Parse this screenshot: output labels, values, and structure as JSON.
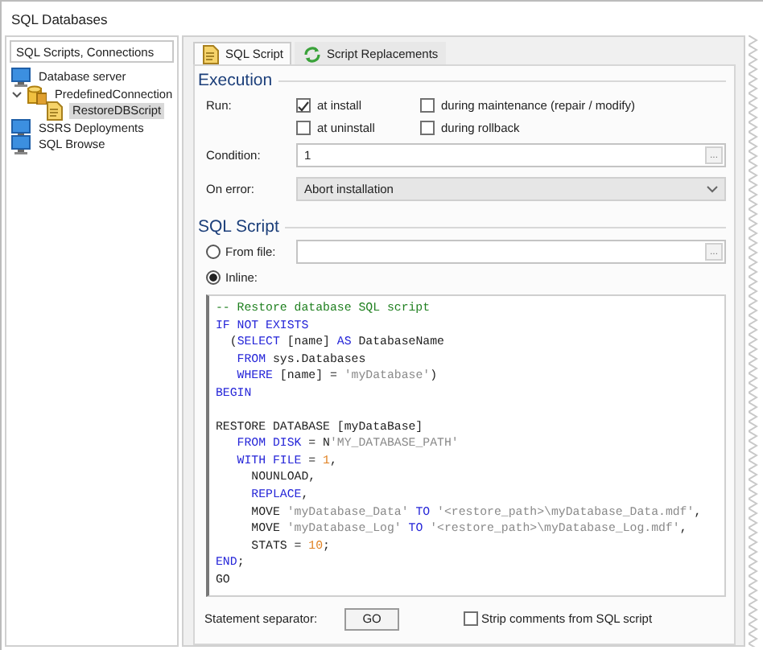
{
  "window": {
    "title": "SQL Databases"
  },
  "sidebar": {
    "header": "SQL Scripts, Connections",
    "items": [
      {
        "label": "Database server",
        "kind": "server",
        "selected": false
      },
      {
        "label": "PredefinedConnection",
        "kind": "connection",
        "selected": false,
        "expanded": true,
        "children": [
          {
            "label": "RestoreDBScript",
            "kind": "script",
            "selected": true
          }
        ]
      },
      {
        "label": "SSRS Deployments",
        "kind": "server",
        "selected": false
      },
      {
        "label": "SQL Browse",
        "kind": "server",
        "selected": false
      }
    ]
  },
  "tabs": [
    {
      "label": "SQL Script",
      "kind": "script",
      "selected": true
    },
    {
      "label": "Script Replacements",
      "kind": "refresh",
      "selected": false
    }
  ],
  "execution": {
    "title": "Execution",
    "run_label": "Run:",
    "options": [
      {
        "label": "at install",
        "checked": true
      },
      {
        "label": "during maintenance (repair / modify)",
        "checked": false
      },
      {
        "label": "at uninstall",
        "checked": false
      },
      {
        "label": "during rollback",
        "checked": false
      }
    ],
    "condition": {
      "label": "Condition:",
      "value": "1",
      "button": "..."
    },
    "on_error": {
      "label": "On error:",
      "value": "Abort installation"
    }
  },
  "sql_script": {
    "title": "SQL Script",
    "sources": [
      {
        "label": "From file:",
        "selected": false,
        "kind": "file",
        "button": "..."
      },
      {
        "label": "Inline:",
        "selected": true,
        "kind": "inline"
      }
    ],
    "code_lines": [
      {
        "kind": "code",
        "tokens": [
          {
            "kind": "comment",
            "text": "-- Restore database SQL script"
          }
        ]
      },
      {
        "kind": "code",
        "tokens": [
          {
            "kind": "keyword",
            "text": "IF NOT EXISTS"
          }
        ]
      },
      {
        "kind": "code",
        "tokens": [
          {
            "kind": "plain",
            "text": "  ("
          },
          {
            "kind": "keyword",
            "text": "SELECT"
          },
          {
            "kind": "plain",
            "text": " [name] "
          },
          {
            "kind": "keyword",
            "text": "AS"
          },
          {
            "kind": "plain",
            "text": " DatabaseName"
          }
        ]
      },
      {
        "kind": "code",
        "tokens": [
          {
            "kind": "keyword",
            "text": "   FROM"
          },
          {
            "kind": "plain",
            "text": " sys.Databases"
          }
        ]
      },
      {
        "kind": "code",
        "tokens": [
          {
            "kind": "keyword",
            "text": "   WHERE"
          },
          {
            "kind": "plain",
            "text": " [name] = "
          },
          {
            "kind": "string",
            "text": "'myDatabase'"
          },
          {
            "kind": "plain",
            "text": ")"
          }
        ]
      },
      {
        "kind": "code",
        "tokens": [
          {
            "kind": "keyword",
            "text": "BEGIN"
          }
        ]
      },
      {
        "kind": "blank"
      },
      {
        "kind": "code",
        "tokens": [
          {
            "kind": "plain",
            "text": "RESTORE DATABASE [myDataBase]"
          }
        ]
      },
      {
        "kind": "code",
        "tokens": [
          {
            "kind": "keyword",
            "text": "   FROM DISK"
          },
          {
            "kind": "plain",
            "text": " = N"
          },
          {
            "kind": "string",
            "text": "'MY_DATABASE_PATH'"
          }
        ]
      },
      {
        "kind": "code",
        "tokens": [
          {
            "kind": "keyword",
            "text": "   WITH FILE"
          },
          {
            "kind": "plain",
            "text": " = "
          },
          {
            "kind": "number",
            "text": "1"
          },
          {
            "kind": "plain",
            "text": ","
          }
        ]
      },
      {
        "kind": "code",
        "tokens": [
          {
            "kind": "plain",
            "text": "     NOUNLOAD,"
          }
        ]
      },
      {
        "kind": "code",
        "tokens": [
          {
            "kind": "keyword",
            "text": "     REPLACE"
          },
          {
            "kind": "plain",
            "text": ","
          }
        ]
      },
      {
        "kind": "code",
        "tokens": [
          {
            "kind": "plain",
            "text": "     MOVE "
          },
          {
            "kind": "string",
            "text": "'myDatabase_Data'"
          },
          {
            "kind": "keyword",
            "text": " TO "
          },
          {
            "kind": "string",
            "text": "'<restore_path>\\myDatabase_Data.mdf'"
          },
          {
            "kind": "plain",
            "text": ","
          }
        ]
      },
      {
        "kind": "code",
        "tokens": [
          {
            "kind": "plain",
            "text": "     MOVE "
          },
          {
            "kind": "string",
            "text": "'myDatabase_Log'"
          },
          {
            "kind": "keyword",
            "text": " TO "
          },
          {
            "kind": "string",
            "text": "'<restore_path>\\myDatabase_Log.mdf'"
          },
          {
            "kind": "plain",
            "text": ","
          }
        ]
      },
      {
        "kind": "code",
        "tokens": [
          {
            "kind": "plain",
            "text": "     STATS = "
          },
          {
            "kind": "number",
            "text": "10"
          },
          {
            "kind": "plain",
            "text": ";"
          }
        ]
      },
      {
        "kind": "code",
        "tokens": [
          {
            "kind": "keyword",
            "text": "END"
          },
          {
            "kind": "plain",
            "text": ";"
          }
        ]
      },
      {
        "kind": "code",
        "tokens": [
          {
            "kind": "plain",
            "text": "GO"
          }
        ]
      }
    ],
    "separator_label": "Statement separator:",
    "separator_value": "GO",
    "strip_comments": {
      "label": "Strip comments from SQL script",
      "checked": false
    }
  }
}
